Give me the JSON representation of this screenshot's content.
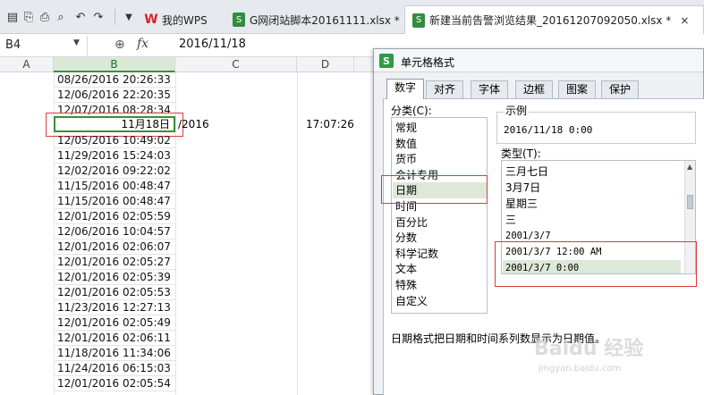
{
  "toolbar": {
    "tabs": [
      {
        "label": "我的WPS"
      },
      {
        "label": "G网闭站脚本20161111.xlsx *"
      },
      {
        "label": "新建当前告警浏览结果_20161207092050.xlsx *"
      }
    ]
  },
  "formula_bar": {
    "name_box": "B4",
    "formula": "2016/11/18"
  },
  "grid": {
    "columns": [
      "A",
      "B",
      "C",
      "D"
    ],
    "rows_above": [
      "08/26/2016 20:26:33",
      "12/06/2016 22:20:35",
      "12/07/2016 08:28:34"
    ],
    "active_cell": {
      "display": "11月18日",
      "overflow": "/2016",
      "d_value": "17:07:26"
    },
    "rows_below": [
      "12/05/2016 10:49:02",
      "11/29/2016 15:24:03",
      "12/02/2016 09:22:02",
      "11/15/2016 00:48:47",
      "11/15/2016 00:48:47",
      "12/01/2016 02:05:59",
      "12/06/2016 10:04:57",
      "12/01/2016 02:06:07",
      "12/01/2016 02:05:27",
      "12/01/2016 02:05:39",
      "12/01/2016 02:05:53",
      "11/23/2016 12:27:13",
      "12/01/2016 02:05:49",
      "12/01/2016 02:06:11",
      "11/18/2016 11:34:06",
      "11/24/2016 06:15:03",
      "12/01/2016 02:05:54"
    ]
  },
  "dialog": {
    "title": "单元格格式",
    "tabs": [
      "数字",
      "对齐",
      "字体",
      "边框",
      "图案",
      "保护"
    ],
    "category_label": "分类(C):",
    "categories": [
      "常规",
      "数值",
      "货币",
      "会计专用",
      "日期",
      "时间",
      "百分比",
      "分数",
      "科学记数",
      "文本",
      "特殊",
      "自定义"
    ],
    "selected_category": "日期",
    "sample_label": "示例",
    "sample_value": "2016/11/18 0:00",
    "type_label": "类型(T):",
    "types": [
      "三月七日",
      "3月7日",
      "星期三",
      "三",
      "2001/3/7",
      "2001/3/7 12:00 AM",
      "2001/3/7 0:00"
    ],
    "selected_type": "2001/3/7 0:00",
    "description": "日期格式把日期和时间系列数显示为日期值。"
  },
  "watermark": {
    "text": "Baidu 经验",
    "url": "jingyan.baidu.com"
  }
}
